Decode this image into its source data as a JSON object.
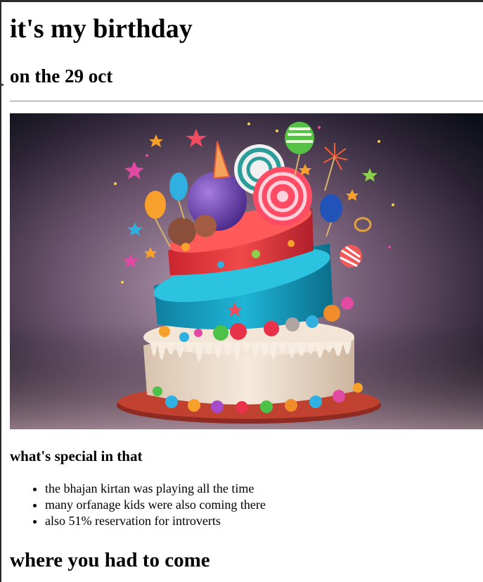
{
  "heading": "it's my birthday",
  "date_heading": "on the 29 oct",
  "image": {
    "subject": "birthday-cake",
    "colors": {
      "background_dark": "#0b0f18",
      "background_glow": "#9b7f9a",
      "top_tier": "#e23a3d",
      "middle_tier": "#19a8c8",
      "bottom_tier": "#efe0cf",
      "plate": "#b8382c"
    }
  },
  "special_heading": "what's special in that",
  "special_items": [
    "the bhajan kirtan was playing all the time",
    "many orfanage kids were also coming there",
    "also 51% reservation for introverts"
  ],
  "where_heading": "where you had to come"
}
